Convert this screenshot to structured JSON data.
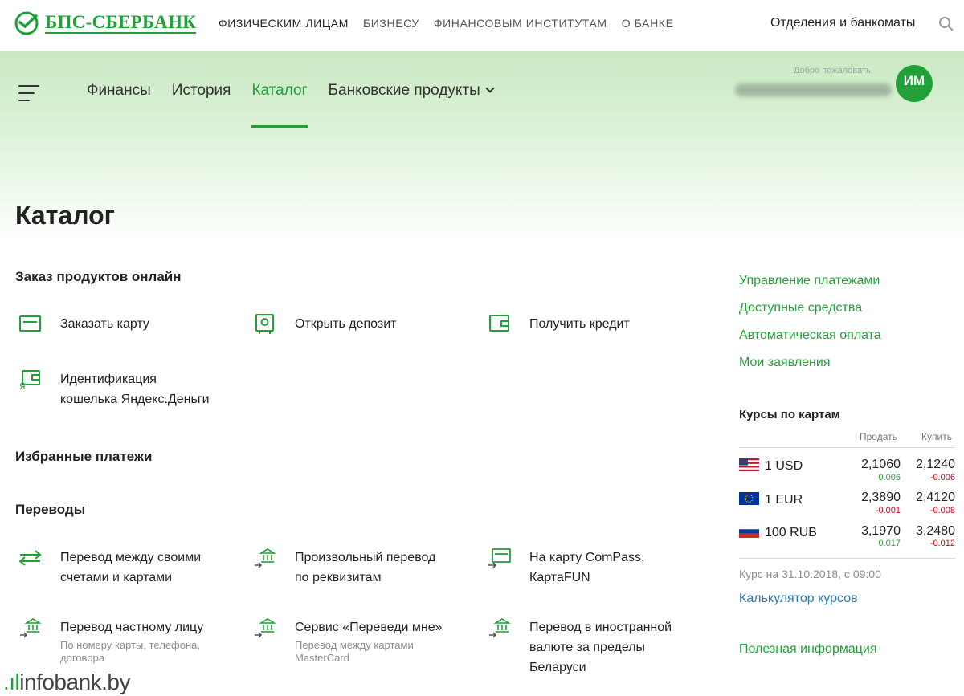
{
  "brand": {
    "name": "БПС-СБЕРБАНК"
  },
  "topnav": {
    "items": [
      "ФИЗИЧЕСКИМ ЛИЦАМ",
      "БИЗНЕСУ",
      "ФИНАНСОВЫМ ИНСТИТУТАМ",
      "О БАНКЕ"
    ],
    "branches": "Отделения и банкоматы"
  },
  "mainnav": {
    "items": [
      "Финансы",
      "История",
      "Каталог",
      "Банковские продукты"
    ],
    "active": "Каталог"
  },
  "user": {
    "welcome": "Добро пожаловать,",
    "initials": "ИМ"
  },
  "page": {
    "title": "Каталог"
  },
  "catalog": {
    "order_title": "Заказ продуктов онлайн",
    "order_items": [
      {
        "label": "Заказать карту",
        "icon": "card-icon"
      },
      {
        "label": "Открыть депозит",
        "icon": "safe-icon"
      },
      {
        "label": "Получить кредит",
        "icon": "wallet-icon"
      },
      {
        "label_line1": "Идентификация",
        "label_line2": "кошелька Яндекс.Деньги",
        "icon": "yandex-wallet-icon"
      }
    ],
    "favorites_title": "Избранные платежи",
    "transfers_title": "Переводы",
    "transfer_items": [
      {
        "label_line1": "Перевод между своими",
        "label_line2": "счетами и картами",
        "icon": "arrows-icon"
      },
      {
        "label_line1": "Произвольный перевод",
        "label_line2": "по реквизитам",
        "icon": "bank-transfer-icon"
      },
      {
        "label_line1": "На карту ComPass,",
        "label_line2": "КартаFUN",
        "icon": "card-transfer-icon"
      },
      {
        "label_line1": "Перевод частному лицу",
        "sub_line1": "По номеру карты, телефона,",
        "sub_line2": "договора",
        "icon": "bank-transfer-icon"
      },
      {
        "label_line1": "Сервис «Переведи мне»",
        "sub_line1": "Перевод между картами",
        "sub_line2": "MasterCard",
        "icon": "bank-transfer-icon"
      },
      {
        "label_line1": "Перевод в иностранной",
        "label_line2": "валюте за пределы",
        "label_line3": "Беларуси",
        "icon": "bank-transfer-icon"
      }
    ]
  },
  "sidebar": {
    "links": [
      "Управление платежами",
      "Доступные средства",
      "Автоматическая оплата",
      "Мои заявления"
    ],
    "rates": {
      "title": "Курсы по картам",
      "sell_label": "Продать",
      "buy_label": "Купить",
      "rows": [
        {
          "currency": "1 USD",
          "flag": "us-flag-icon",
          "sell": "2,1060",
          "sell_change": "0.006",
          "sell_dir": "up",
          "buy": "2,1240",
          "buy_change": "-0.006",
          "buy_dir": "down"
        },
        {
          "currency": "1 EUR",
          "flag": "eu-flag-icon",
          "sell": "2,3890",
          "sell_change": "-0.001",
          "sell_dir": "down",
          "buy": "2,4120",
          "buy_change": "-0.008",
          "buy_dir": "down"
        },
        {
          "currency": "100 RUB",
          "flag": "ru-flag-icon",
          "sell": "3,1970",
          "sell_change": "0.017",
          "sell_dir": "up",
          "buy": "3,2480",
          "buy_change": "-0.012",
          "buy_dir": "down"
        }
      ],
      "date": "Курс на 31.10.2018, с 09:00",
      "calculator": "Калькулятор курсов"
    },
    "useful": "Полезная информация"
  },
  "watermark": {
    "dots": ".ıl",
    "text": "infobank.by"
  },
  "colors": {
    "accent": "#21a038",
    "link_blue": "#2a7ab0",
    "negative": "#d0021b"
  }
}
